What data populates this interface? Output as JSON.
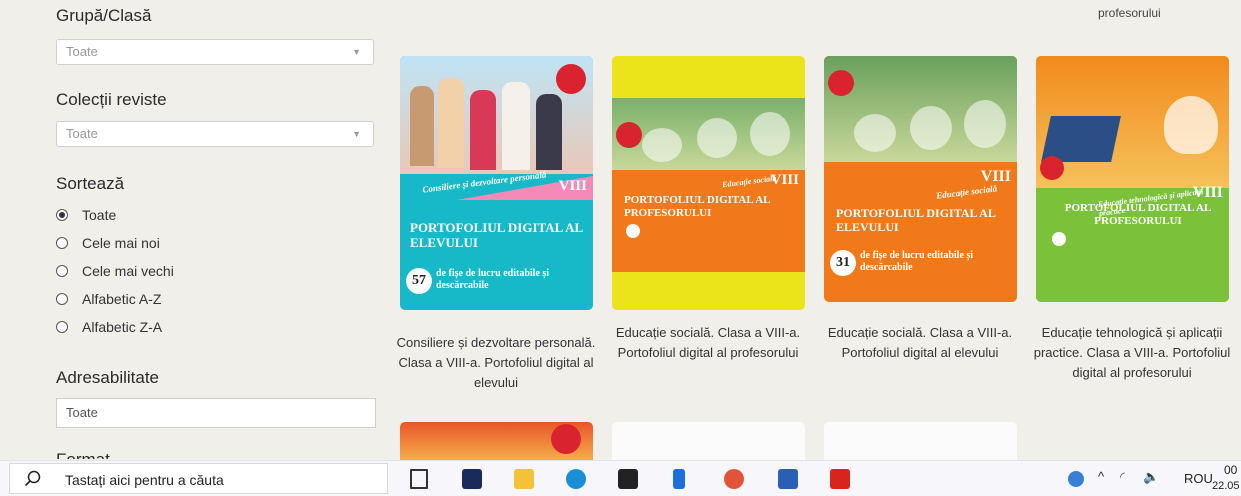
{
  "filters": {
    "group_class": {
      "title": "Grupă/Clasă",
      "selected": "Toate"
    },
    "collections": {
      "title": "Colecții reviste",
      "selected": "Toate"
    },
    "sort": {
      "title": "Sortează",
      "options": [
        "Toate",
        "Cele mai noi",
        "Cele mai vechi",
        "Alfabetic A-Z",
        "Alfabetic Z-A"
      ],
      "selected_index": 0
    },
    "addressability": {
      "title": "Adresabilitate",
      "value": "Toate"
    },
    "format": {
      "title": "Format"
    }
  },
  "top_fragment": "profesorului",
  "products": [
    {
      "title": "Consiliere și dezvoltare personală. Clasa a VIII-a. Portofoliul digital al elevului",
      "cover_heading": "PORTOFOLIUL DIGITAL AL ELEVULUI",
      "cover_subject": "Consiliere și dezvoltare personală",
      "cover_grade": "VIII",
      "cover_badge_text": "57",
      "cover_tagline": "de fișe de lucru editabile și descărcabile",
      "cover_color": "#17b8c8"
    },
    {
      "title": "Educație socială. Clasa a VIII-a. Portofoliul digital al profesorului",
      "cover_heading": "PORTOFOLIUL DIGITAL AL PROFESORULUI",
      "cover_subject": "Educație socială",
      "cover_grade": "VIII",
      "cover_color": "#f07a1a"
    },
    {
      "title": "Educație socială. Clasa a VIII-a. Portofoliul digital al elevului",
      "cover_heading": "PORTOFOLIUL DIGITAL AL ELEVULUI",
      "cover_subject": "Educație socială",
      "cover_grade": "VIII",
      "cover_badge_text": "31",
      "cover_tagline": "de fișe de lucru editabile și descărcabile",
      "cover_color": "#f07a1a"
    },
    {
      "title": "Educație tehnologică și aplicații practice. Clasa a VIII-a. Portofoliul digital al profesorului",
      "cover_heading": "PORTOFOLIUL DIGITAL AL PROFESORULUI",
      "cover_subject": "Educație tehnologică și aplicații practice",
      "cover_grade": "VIII",
      "cover_color": "#7bc23a"
    }
  ],
  "taskbar": {
    "search_placeholder": "Tastați aici pentru a căuta",
    "language": "ROU",
    "time": "00",
    "date": "22.05",
    "apps": [
      "task-view-icon",
      "app-s-icon",
      "file-explorer-icon",
      "edge-icon",
      "store-icon",
      "phone-icon",
      "firefox-icon",
      "word-icon",
      "acrobat-icon"
    ]
  }
}
